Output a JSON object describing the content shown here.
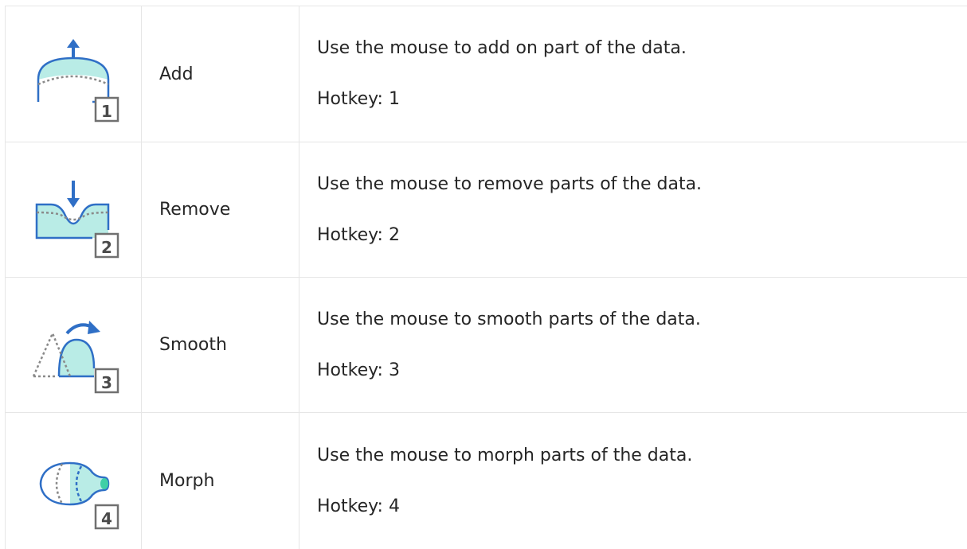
{
  "tools": [
    {
      "icon": "add-tool-icon",
      "hotkey_badge": "1",
      "name": "Add",
      "description": "Use the mouse to add on part of the data.",
      "hotkey": "Hotkey: 1"
    },
    {
      "icon": "remove-tool-icon",
      "hotkey_badge": "2",
      "name": "Remove",
      "description": "Use the mouse to remove parts of the data.",
      "hotkey": "Hotkey: 2"
    },
    {
      "icon": "smooth-tool-icon",
      "hotkey_badge": "3",
      "name": "Smooth",
      "description": "Use the mouse to smooth parts of the data.",
      "hotkey": "Hotkey: 3"
    },
    {
      "icon": "morph-tool-icon",
      "hotkey_badge": "4",
      "name": "Morph",
      "description": "Use the mouse to morph parts of the data.",
      "hotkey": "Hotkey: 4"
    }
  ],
  "colors": {
    "accent_blue": "#2f6fc6",
    "fill_teal": "#b9ece6",
    "dash_gray": "#8a8a8a",
    "border": "#e6e6e6",
    "text": "#262626"
  }
}
